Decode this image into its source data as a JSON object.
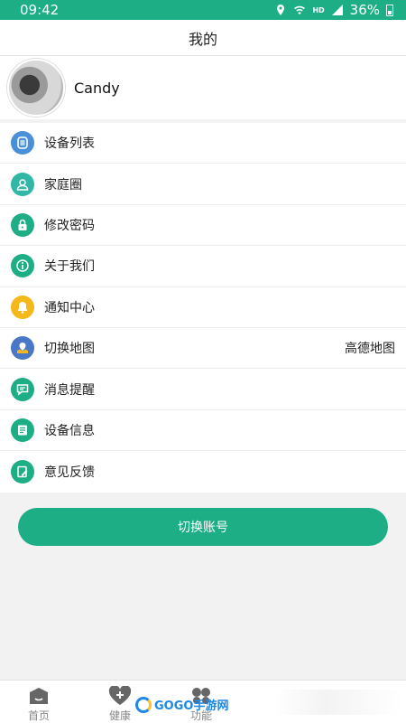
{
  "status_bar": {
    "time": "09:42",
    "network": "HD",
    "battery": "36%"
  },
  "header": {
    "title": "我的"
  },
  "profile": {
    "name": "Candy"
  },
  "menu": [
    {
      "label": "设备列表",
      "icon": "device-list-icon",
      "color": "#4a90d9"
    },
    {
      "label": "家庭圈",
      "icon": "family-icon",
      "color": "#31b7a6"
    },
    {
      "label": "修改密码",
      "icon": "lock-icon",
      "color": "#1dae86"
    },
    {
      "label": "关于我们",
      "icon": "info-icon",
      "color": "#1dae86"
    },
    {
      "label": "通知中心",
      "icon": "bell-icon",
      "color": "#f5b81b"
    },
    {
      "label": "切换地图",
      "icon": "map-icon",
      "color": "#4a78c8",
      "value": "高德地图"
    },
    {
      "label": "消息提醒",
      "icon": "message-icon",
      "color": "#1dae86"
    },
    {
      "label": "设备信息",
      "icon": "device-info-icon",
      "color": "#1dae86"
    },
    {
      "label": "意见反馈",
      "icon": "feedback-icon",
      "color": "#1dae86"
    }
  ],
  "switch_account": {
    "label": "切换账号"
  },
  "tabs": [
    {
      "label": "首页",
      "icon": "home-icon"
    },
    {
      "label": "健康",
      "icon": "health-icon"
    },
    {
      "label": "功能",
      "icon": "function-icon"
    }
  ],
  "watermark": {
    "text": "GOGO手游网"
  },
  "colors": {
    "primary": "#1dae86",
    "background": "#f2f2f2"
  }
}
